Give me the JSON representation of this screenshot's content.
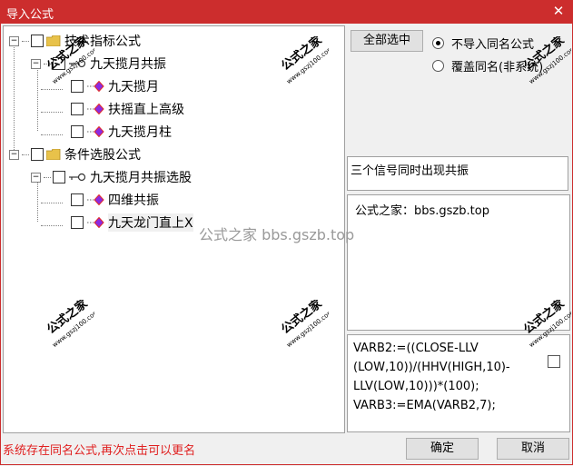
{
  "window": {
    "title": "导入公式",
    "close_glyph": "✕"
  },
  "tree": {
    "nodes": [
      {
        "label": "技术指标公式",
        "expander": "−",
        "icon": "folder-icon"
      },
      {
        "label": "九天揽月共振",
        "expander": "−",
        "icon": "key-icon"
      },
      {
        "label": "九天揽月",
        "icon": "formula-diamond-icon"
      },
      {
        "label": "扶摇直上高级",
        "icon": "formula-diamond-icon"
      },
      {
        "label": "九天揽月柱",
        "icon": "formula-diamond-icon"
      },
      {
        "label": "条件选股公式",
        "expander": "−",
        "icon": "folder-icon"
      },
      {
        "label": "九天揽月共振选股",
        "expander": "−",
        "icon": "key-icon"
      },
      {
        "label": "四维共振",
        "icon": "formula-diamond-icon"
      },
      {
        "label": "九天龙门直上X",
        "icon": "formula-diamond-icon"
      }
    ]
  },
  "options": {
    "select_all_label": "全部选中",
    "radio_no_import": "不导入同名公式",
    "radio_overwrite": "覆盖同名(非系统)",
    "selected": "radio_no_import"
  },
  "detail": {
    "description": "三个信号同时出现共振",
    "source": "公式之家：bbs.gszb.top",
    "code": "VARB2:=((CLOSE-LLV\n(LOW,10))/(HHV(HIGH,10)-\nLLV(LOW,10)))*(100);\nVARB3:=EMA(VARB2,7);"
  },
  "status_message": "系统存在同名公式,再次点击可以更名",
  "buttons": {
    "confirm": "确定",
    "cancel": "取消"
  },
  "watermark": {
    "center": "公式之家 bbs.gszb.top",
    "stamp_title": "公式之家",
    "stamp_url": "www.gszj100.com"
  },
  "colors": {
    "title_bar": "#cc2d2d",
    "status_text": "#e02020",
    "folder": "#e8c24a",
    "diamond": "#8a2be2"
  }
}
